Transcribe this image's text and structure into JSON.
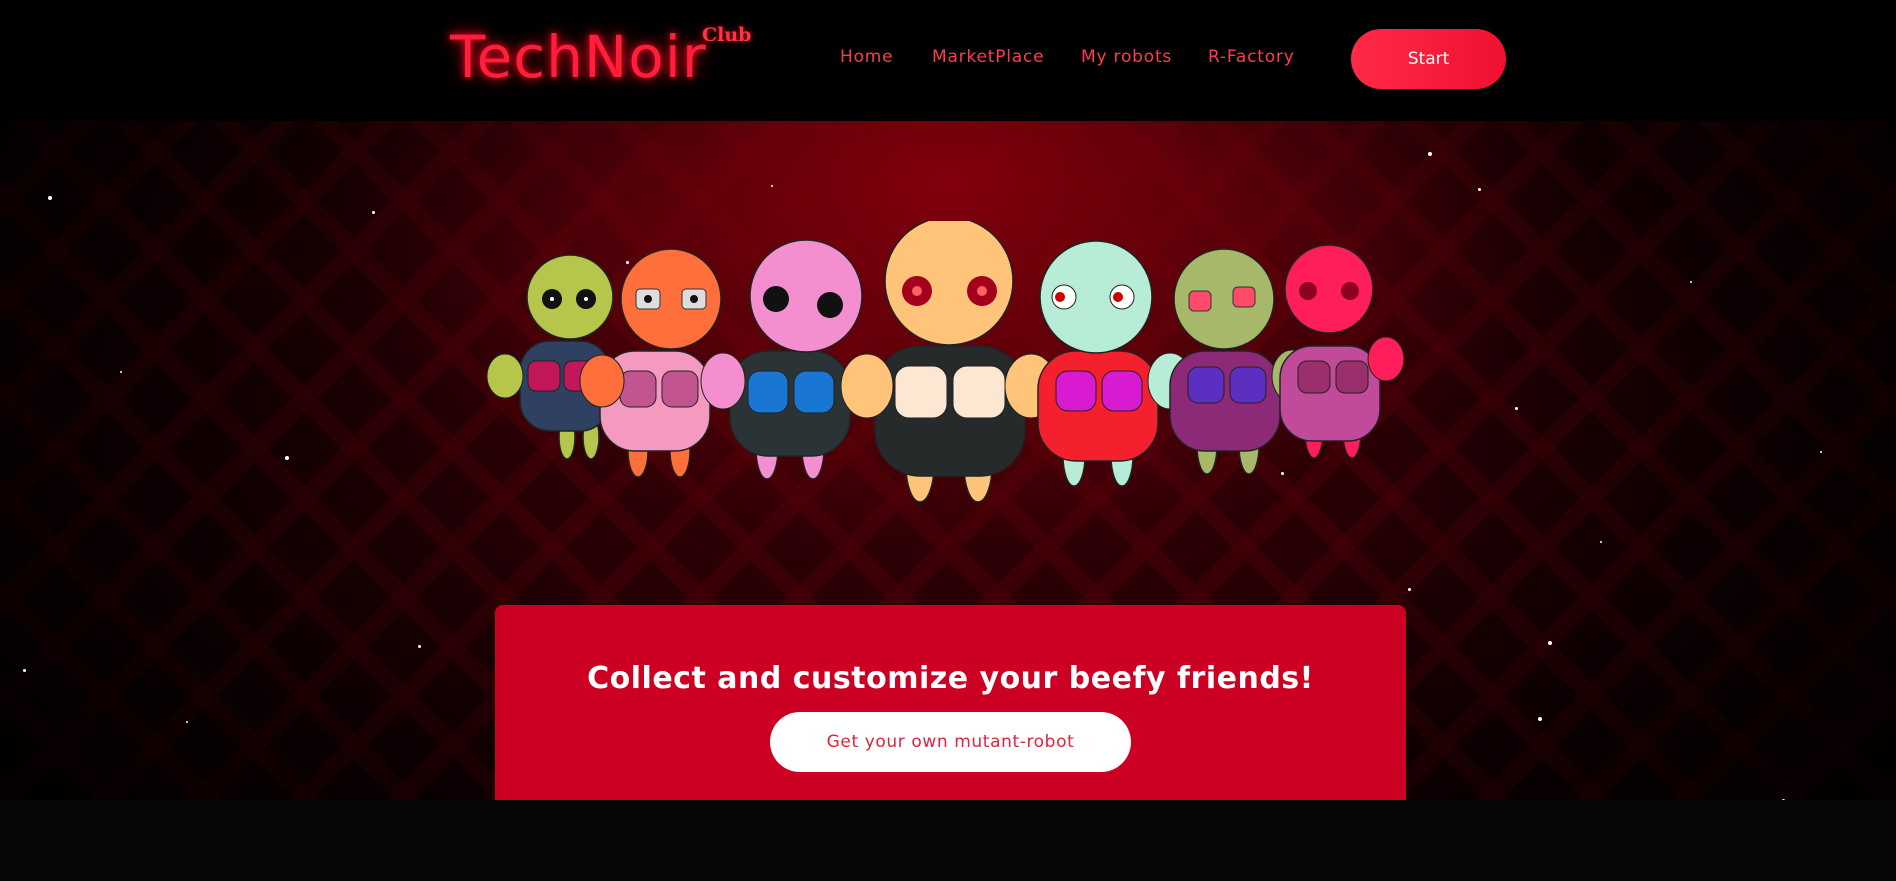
{
  "header": {
    "logo_text": "TechNoir",
    "logo_sup": "Club",
    "nav": [
      {
        "label": "Home"
      },
      {
        "label": "MarketPlace"
      },
      {
        "label": "My robots"
      },
      {
        "label": "R-Factory"
      }
    ],
    "start_label": "Start"
  },
  "hero": {
    "tagline": "Collect and customize your beefy friends!",
    "cta_label": "Get your own mutant-robot"
  },
  "colors": {
    "accent": "#ff1e3c",
    "card": "#cc0022",
    "background": "#000000"
  }
}
